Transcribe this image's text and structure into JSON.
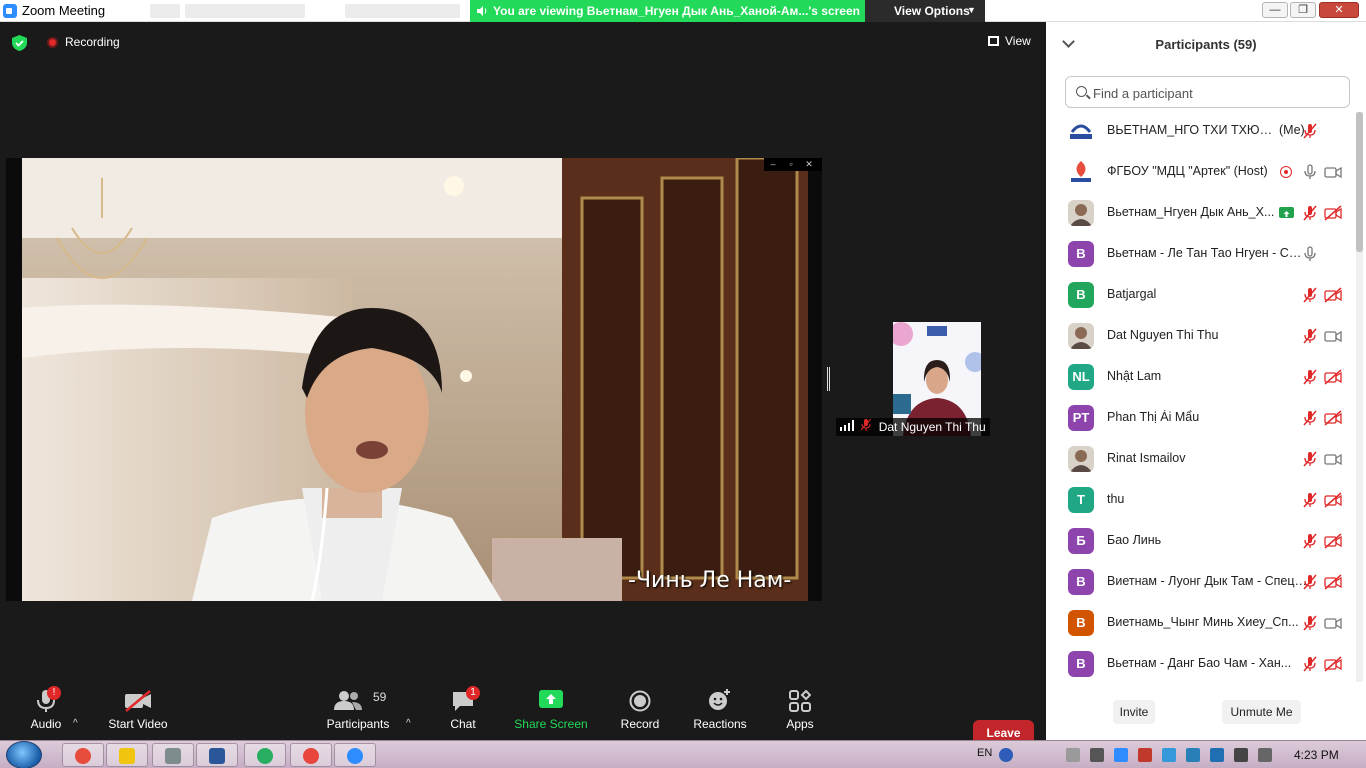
{
  "window": {
    "title": "Zoom Meeting",
    "share_banner": "You are viewing Вьетнам_Нгуен Дык Ань_Ханой-Ам...'s screen",
    "view_options": "View Options"
  },
  "meeting": {
    "recording_label": "Recording",
    "view_label": "View",
    "subtitle": "-Чинь Ле Нам-",
    "thumbnail_name": "Dat Nguyen Thi Thu"
  },
  "toolbar": {
    "audio": "Audio",
    "start_video": "Start Video",
    "participants": "Participants",
    "participants_count": "59",
    "chat": "Chat",
    "chat_badge": "1",
    "share_screen": "Share Screen",
    "record": "Record",
    "reactions": "Reactions",
    "apps": "Apps",
    "leave": "Leave"
  },
  "panel": {
    "title": "Participants (59)",
    "search_placeholder": "Find a participant",
    "invite": "Invite",
    "unmute_me": "Unmute Me",
    "participants": [
      {
        "name": "ВЬЕТНАМ_НГО ТХИ ТХЮИ Х...",
        "tag": "(Me)",
        "avatar": "logo",
        "audio": "muted",
        "video": "none"
      },
      {
        "name": "ФГБОУ \"МДЦ \"Артек\" (Host)",
        "avatar": "logo2",
        "audio": "on",
        "video": "on",
        "recording": true
      },
      {
        "name": "Вьетнам_Нгуен Дык Ань_Х...",
        "avatar": "photo",
        "audio": "muted",
        "video": "off",
        "sharing": true
      },
      {
        "name": "Вьетнам - Ле Тан Тао Нгуен - Спе...",
        "initials": "В",
        "color": "#8e44ad",
        "audio": "on",
        "video": "none"
      },
      {
        "name": "Batjargal",
        "initials": "B",
        "color": "#22a55c",
        "audio": "muted",
        "video": "off"
      },
      {
        "name": "Dat Nguyen Thi Thu",
        "avatar": "photo",
        "audio": "muted",
        "video": "on"
      },
      {
        "name": "Nhật Lam",
        "initials": "NL",
        "color": "#1fa883",
        "audio": "muted",
        "video": "off"
      },
      {
        "name": "Phan Thị Ái Mẩu",
        "initials": "PT",
        "color": "#8e44ad",
        "audio": "muted",
        "video": "off"
      },
      {
        "name": "Rinat Ismailov",
        "avatar": "photo",
        "audio": "muted",
        "video": "on"
      },
      {
        "name": "thu",
        "initials": "T",
        "color": "#1fa883",
        "audio": "muted",
        "video": "off"
      },
      {
        "name": "Бао Линь",
        "initials": "Б",
        "color": "#8e44ad",
        "audio": "muted",
        "video": "off"
      },
      {
        "name": "Виетнам - Луонг Дык Там - Спецш...",
        "initials": "В",
        "color": "#8e44ad",
        "audio": "muted",
        "video": "off"
      },
      {
        "name": "Виетнамь_Чынг Минь Хиеу_Сп...",
        "initials": "В",
        "color": "#d35400",
        "audio": "muted",
        "video": "on"
      },
      {
        "name": "Вьетнам - Данг Бао Чам - Хан...",
        "initials": "В",
        "color": "#8e44ad",
        "audio": "muted",
        "video": "off"
      }
    ]
  },
  "taskbar": {
    "language": "EN",
    "clock": "4:23 PM"
  },
  "colors": {
    "zoom_blue": "#2d8cff",
    "share_green": "#23d959",
    "leave_red": "#c2262a",
    "muted_red": "#e02828"
  }
}
